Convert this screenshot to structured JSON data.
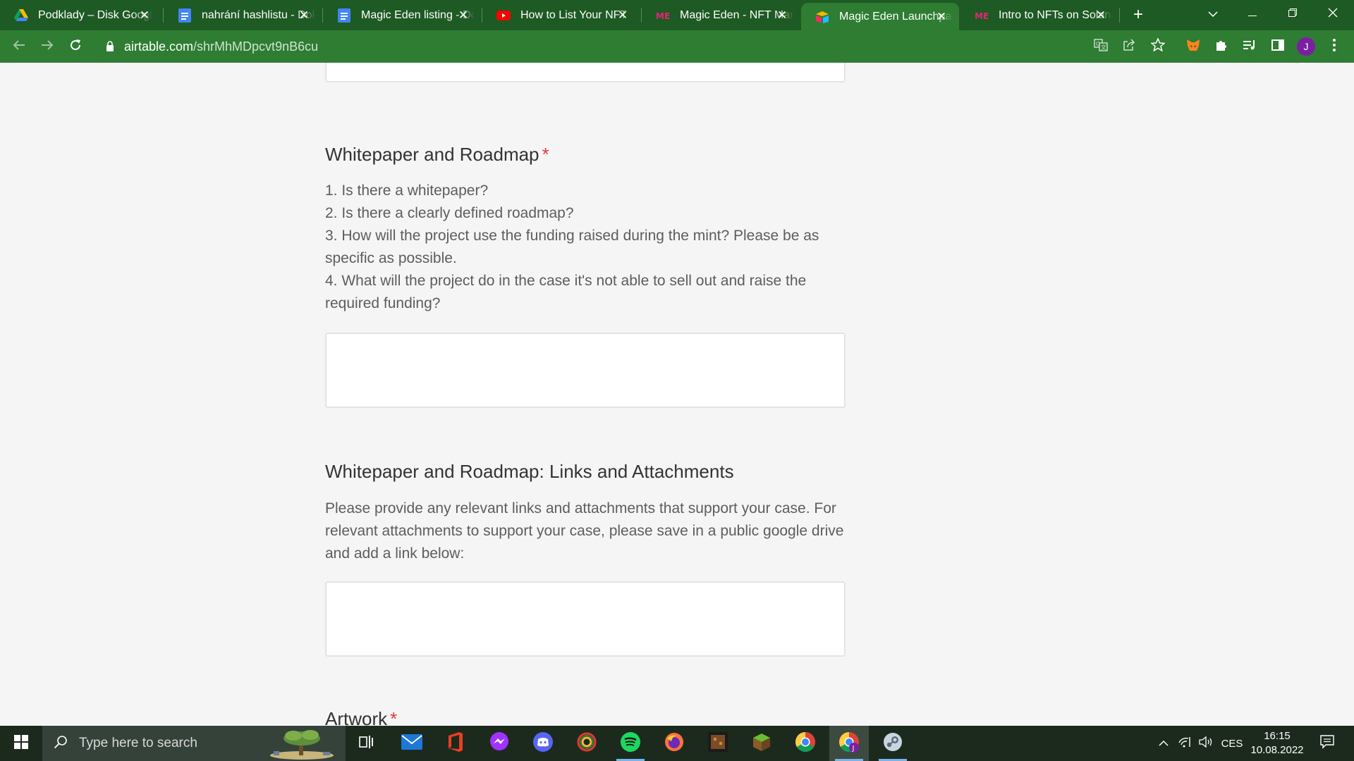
{
  "browser": {
    "tabs": [
      {
        "title": "Podklady – Disk Google",
        "favicon": "google-drive-icon",
        "active": false
      },
      {
        "title": "nahrání hashlistu - Dokumenty Google",
        "favicon": "google-docs-icon",
        "active": false
      },
      {
        "title": "Magic Eden listing - Dokumenty Google",
        "favicon": "google-docs-icon",
        "active": false
      },
      {
        "title": "How to List Your NFT",
        "favicon": "youtube-icon",
        "active": false
      },
      {
        "title": "Magic Eden - NFT Marketplace",
        "favicon": "magic-eden-icon",
        "active": false
      },
      {
        "title": "Magic Eden Launchpad",
        "favicon": "airtable-icon",
        "active": true
      },
      {
        "title": "Intro to NFTs on Solana",
        "favicon": "magic-eden-icon",
        "active": false
      }
    ],
    "url_domain": "airtable.com",
    "url_path": "/shrMhMDpcvt9nB6cu",
    "profile_initial": "J",
    "colors": {
      "frame": "#1e5a23",
      "toolbar": "#2e7d32"
    }
  },
  "form": {
    "q1": {
      "title": "Whitepaper and Roadmap",
      "required_mark": "*",
      "lines": [
        "1. Is there a whitepaper?",
        "2. Is there a clearly defined roadmap?",
        "3. How will the project use the funding raised during the mint? Please be as specific as possible.",
        "4. What will the project do in the case it's not able to sell out and raise the required funding?"
      ],
      "value": ""
    },
    "q2": {
      "title": "Whitepaper and Roadmap: Links and Attachments",
      "description": "Please provide any relevant links and attachments that support your case. For relevant attachments to support your case, please save in a public google drive and add a link below:",
      "value": ""
    },
    "q3": {
      "title": "Artwork",
      "required_mark": "*"
    }
  },
  "taskbar": {
    "search_placeholder": "Type here to search",
    "apps": [
      "task-view-icon",
      "mail-icon",
      "office-icon",
      "messenger-icon",
      "discord-icon",
      "brave-icon",
      "spotify-icon",
      "firefox-icon",
      "minecraft-dungeons-icon",
      "minecraft-icon",
      "chrome-icon",
      "chrome-profile-icon",
      "steam-icon"
    ],
    "language": "CES",
    "time": "16:15",
    "date": "10.08.2022"
  }
}
